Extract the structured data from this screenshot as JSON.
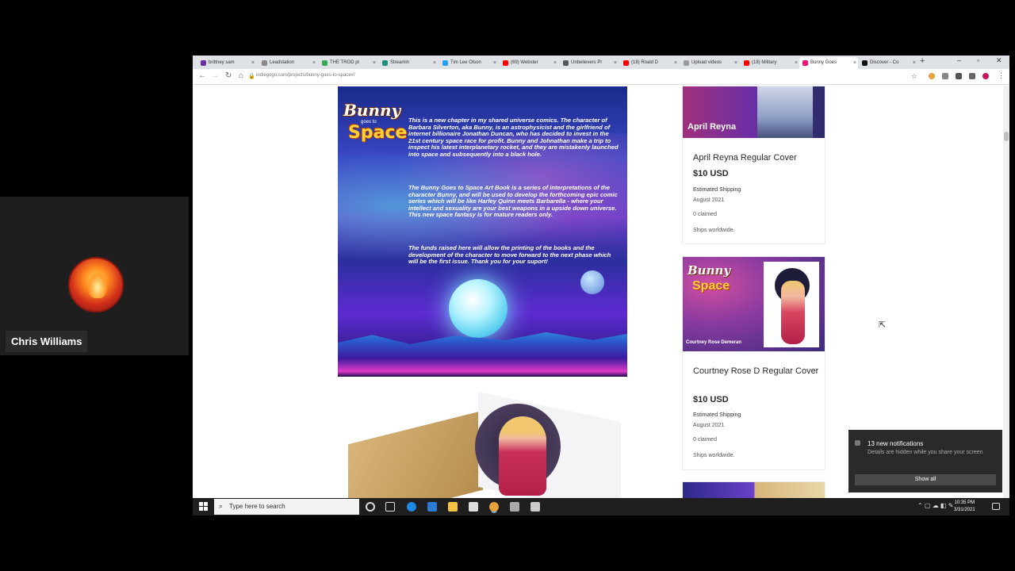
{
  "participant": {
    "name": "Chris Williams"
  },
  "browser": {
    "tabs": [
      {
        "label": "brittney sam",
        "fav_color": "#6b2fa5"
      },
      {
        "label": "Leadstation",
        "fav_color": "#888888"
      },
      {
        "label": "THE TROD pl",
        "fav_color": "#34a853"
      },
      {
        "label": "Streamin",
        "fav_color": "#1e8e7e"
      },
      {
        "label": "Tim Lee Olson",
        "fav_color": "#1da1f2"
      },
      {
        "label": "(69) Webster",
        "fav_color": "#ff0000"
      },
      {
        "label": "Unbelievers Pl",
        "fav_color": "#555555"
      },
      {
        "label": "(18) Roald D",
        "fav_color": "#ff0000"
      },
      {
        "label": "Upload videos",
        "fav_color": "#999999"
      },
      {
        "label": "(18) Military",
        "fav_color": "#ff0000"
      },
      {
        "label": "Bunny Goes",
        "fav_color": "#eb1478"
      },
      {
        "label": "Discover - Co",
        "fav_color": "#111111"
      }
    ],
    "new_tab": "+",
    "url": "indiegogo.com/projects/bunny-goes-to-space#/"
  },
  "campaign": {
    "logo": {
      "line1": "Bunny",
      "line2": "goes to",
      "line3": "Space"
    },
    "paragraphs": [
      "This is a new chapter in my shared universe comics. The character of Barbara Silverton, aka Bunny, is an astrophysicist and the girlfriend of internet billionaire Jonathan Duncan, who has decided to invest in the 21st century space race for profit. Bunny and Johnathan make a trip to inspect his latest interplanetary rocket, and they are mistakenly launched into space and subsequently into a black hole.",
      "The Bunny Goes to Space Art Book is a series of interpretations of the character Bunny, and will be used to develop the forthcoming epic comic series which will be like Harley Quinn meets Barbarella - where your intellect and sexuality are your best weapons in a upside down universe. This new space fantasy is for mature readers only.",
      "The funds raised here will allow the printing of the books and the development of the character to move forward to the next phase which will be the first issue. Thank you for your suport!"
    ]
  },
  "rewards": [
    {
      "image_label": "April Reyna",
      "title": "April Reyna Regular Cover",
      "price": "$10 USD",
      "shipping_label": "Estimated Shipping",
      "shipping_date": "August 2021",
      "claimed": "0 claimed",
      "ships": "Ships worldwide."
    },
    {
      "image_label": "Courtney Rose Demeran",
      "title": "Courtney Rose D Regular Cover",
      "price": "$10 USD",
      "shipping_label": "Estimated Shipping",
      "shipping_date": "August 2021",
      "claimed": "0 claimed",
      "ships": "Ships worldwide."
    }
  ],
  "notification": {
    "title": "13 new notifications",
    "detail": "Details are hidden while you share your screen",
    "button": "Show all"
  },
  "taskbar": {
    "search_placeholder": "Type here to search",
    "time": "10:35 PM",
    "date": "3/31/2021"
  }
}
